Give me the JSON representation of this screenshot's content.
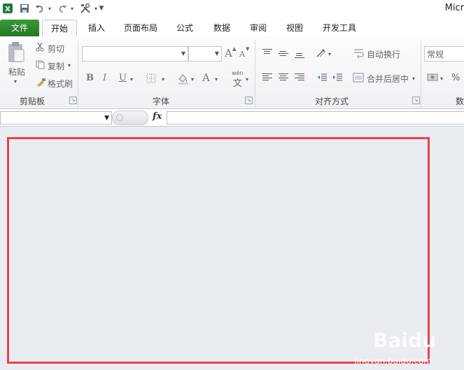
{
  "window": {
    "title": "Micr",
    "qat": {
      "customize_caret": "▼"
    }
  },
  "tabs": [
    "文件",
    "开始",
    "插入",
    "页面布局",
    "公式",
    "数据",
    "审阅",
    "视图",
    "开发工具"
  ],
  "clipboard": {
    "paste_label": "粘贴",
    "cut_label": "剪切",
    "copy_label": "复制",
    "format_painter_label": "格式刷",
    "group_label": "剪贴板"
  },
  "font": {
    "grow_label": "A",
    "shrink_label": "A",
    "bold_label": "B",
    "italic_label": "I",
    "underline_label": "U",
    "font_color_label": "A",
    "phonetic_label": "wén",
    "phonetic_char": "文",
    "group_label": "字体"
  },
  "alignment": {
    "wrap_label": "自动换行",
    "merge_label": "合并后居中",
    "group_label": "对齐方式"
  },
  "number": {
    "format_value": "常规",
    "percent_label": "%",
    "group_label": "数"
  },
  "formula_bar": {
    "fx_label": "fx"
  },
  "watermark": {
    "brand": "Baidu",
    "sub": "jingyan.baidu.com"
  },
  "colors": {
    "file_tab": "#217821",
    "highlight_border": "#e8444a",
    "workspace": "#e9ecf0"
  }
}
